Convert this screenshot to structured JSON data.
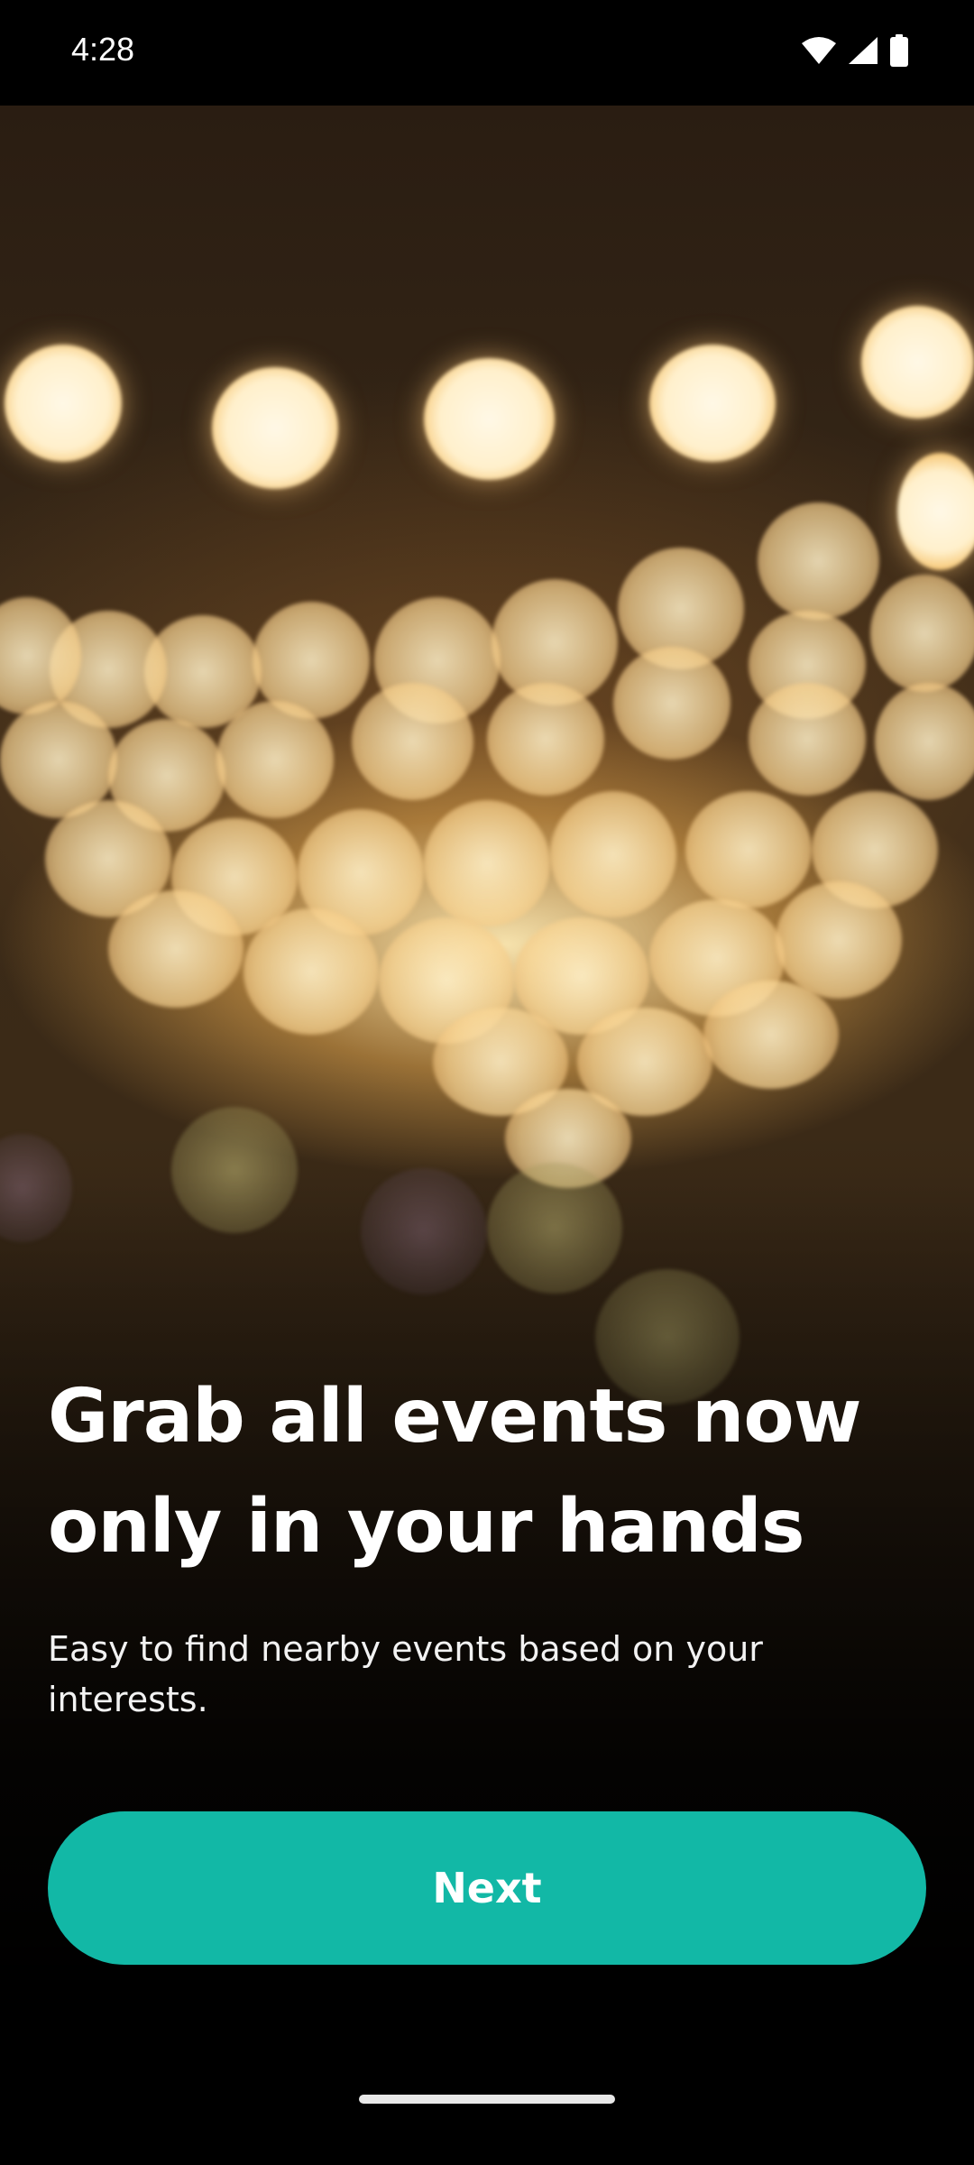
{
  "status_bar": {
    "time": "4:28",
    "icons": [
      "wifi-icon",
      "signal-icon",
      "battery-icon"
    ]
  },
  "onboarding": {
    "headline_line1": "Grab all events now",
    "headline_line2": "only in your hands",
    "subtitle_line1": "Easy to find nearby events based on your",
    "subtitle_line2": "interests.",
    "next_label": "Next"
  },
  "colors": {
    "accent": "#12b8a6",
    "background": "#000000",
    "text": "#ffffff"
  }
}
